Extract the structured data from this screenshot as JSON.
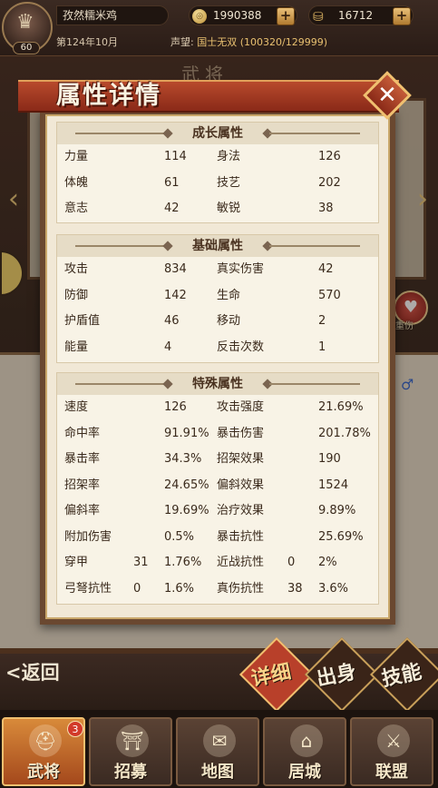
{
  "player": {
    "name": "孜然糯米鸡",
    "level": "60",
    "date": "第124年10月",
    "prestige_label": "声望:",
    "prestige_value": "国士无双 (100320/129999)"
  },
  "resources": {
    "gold": "1990388",
    "copper": "16712"
  },
  "background": {
    "title": "武将",
    "heal_label": "重伤"
  },
  "modal": {
    "title": "属性详情",
    "sections": {
      "growth": {
        "title": "成长属性",
        "rows": [
          [
            "力量",
            "114",
            "身法",
            "126"
          ],
          [
            "体魄",
            "61",
            "技艺",
            "202"
          ],
          [
            "意志",
            "42",
            "敏锐",
            "38"
          ]
        ]
      },
      "basic": {
        "title": "基础属性",
        "rows": [
          [
            "攻击",
            "834",
            "真实伤害",
            "42"
          ],
          [
            "防御",
            "142",
            "生命",
            "570"
          ],
          [
            "护盾值",
            "46",
            "移动",
            "2"
          ],
          [
            "能量",
            "4",
            "反击次数",
            "1"
          ]
        ]
      },
      "special": {
        "title": "特殊属性",
        "rows": [
          [
            "速度",
            "126",
            "攻击强度",
            "21.69%"
          ],
          [
            "命中率",
            "91.91%",
            "暴击伤害",
            "201.78%"
          ],
          [
            "暴击率",
            "34.3%",
            "招架效果",
            "190"
          ],
          [
            "招架率",
            "24.65%",
            "偏斜效果",
            "1524"
          ],
          [
            "偏斜率",
            "19.69%",
            "治疗效果",
            "9.89%"
          ],
          [
            "附加伤害",
            "0.5%",
            "暴击抗性",
            "25.69%"
          ]
        ],
        "extended_rows": [
          [
            "穿甲",
            "31",
            "1.76%",
            "近战抗性",
            "0",
            "2%"
          ],
          [
            "弓弩抗性",
            "0",
            "1.6%",
            "真伤抗性",
            "38",
            "3.6%"
          ]
        ]
      }
    }
  },
  "actions": {
    "back": "<返回",
    "detail": "详细",
    "origin": "出身",
    "skill": "技能"
  },
  "nav": {
    "items": [
      {
        "label": "武将",
        "badge": "3"
      },
      {
        "label": "招募"
      },
      {
        "label": "地图"
      },
      {
        "label": "居城"
      },
      {
        "label": "联盟"
      }
    ]
  },
  "colors": {
    "accent_red": "#b84a2c",
    "gold_accent": "#e8c070",
    "panel_bg": "#f1e8d6"
  }
}
